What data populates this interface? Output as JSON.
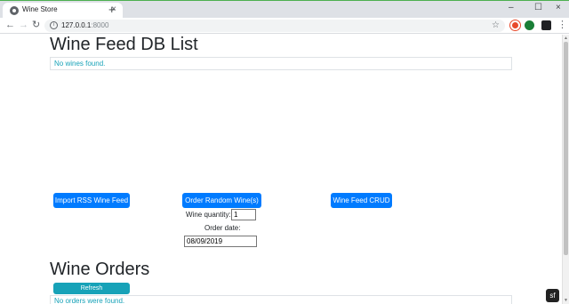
{
  "browser": {
    "tab_title": "Wine Store",
    "tab_close_glyph": "×",
    "new_tab_glyph": "+",
    "url_host": "127.0.0.1",
    "url_port": ":8000",
    "icons": [
      "globe-icon",
      "back-icon",
      "forward-icon",
      "reload-icon",
      "info-icon",
      "star-icon",
      "menu-icon"
    ],
    "window_controls": [
      "–",
      "☐",
      "×"
    ]
  },
  "page": {
    "wine_feed_title": "Wine Feed DB List",
    "wine_feed_empty": "No wines found.",
    "import_button": "Import RSS Wine Feed",
    "order_button": "Order Random Wine(s)",
    "crud_button": "Wine Feed CRUD",
    "quantity_label": "Wine quantity:",
    "quantity_value": "1",
    "order_date_label": "Order date:",
    "order_date_value": "08/09/2019",
    "orders_title": "Wine Orders",
    "refresh_button": "Refresh",
    "orders_empty": "No orders were found.",
    "symfony_badge": "sf"
  },
  "colors": {
    "primary": "#007bff",
    "info": "#17a2b8",
    "text": "#212529"
  }
}
